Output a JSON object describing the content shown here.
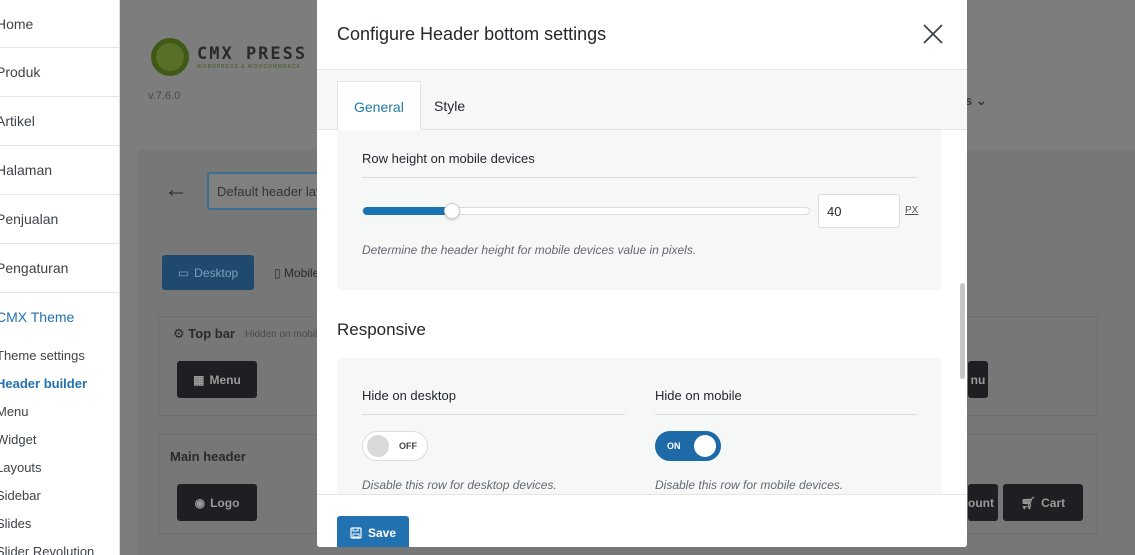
{
  "sidebar": {
    "main_items": [
      {
        "label": "Home"
      },
      {
        "label": "Produk"
      },
      {
        "label": "Artikel"
      },
      {
        "label": "Halaman"
      },
      {
        "label": "Penjualan"
      },
      {
        "label": "Pengaturan"
      }
    ],
    "active_section": "CMX Theme",
    "sub_items": [
      {
        "label": "Theme settings"
      },
      {
        "label": "Header builder"
      },
      {
        "label": "Menu"
      },
      {
        "label": "Widget"
      },
      {
        "label": "Layouts"
      },
      {
        "label": "Sidebar"
      },
      {
        "label": "Slides"
      },
      {
        "label": "Slider Revolution"
      }
    ]
  },
  "background_page": {
    "brand": "CMX PRESS",
    "tagline": "WORDPRESS & WOOCOMMERCE",
    "version": "v.7.6.0",
    "header_input": "Default header layout",
    "device_tabs": [
      "Desktop",
      "Mobile"
    ],
    "rows": {
      "top_bar": "Top bar",
      "top_bar_note": "Hidden on mobile",
      "main_header": "Main header"
    },
    "buttons": {
      "menu": "Menu",
      "logo": "Logo",
      "account": "Account",
      "cart": "Cart"
    },
    "colors": {
      "accent": "#2271b1"
    }
  },
  "modal": {
    "title": "Configure Header bottom settings",
    "tabs": [
      {
        "label": "General",
        "active": true
      },
      {
        "label": "Style",
        "active": false
      }
    ],
    "row_height": {
      "label": "Row height on mobile devices",
      "value": "40",
      "unit": "PX",
      "description": "Determine the header height for mobile devices value in pixels.",
      "slider_fraction": 0.2
    },
    "responsive": {
      "title": "Responsive",
      "hide_desktop": {
        "label": "Hide on desktop",
        "state_text": "OFF",
        "description": "Disable this row for desktop devices."
      },
      "hide_mobile": {
        "label": "Hide on mobile",
        "state_text": "ON",
        "description": "Disable this row for mobile devices."
      }
    },
    "save_label": "Save"
  }
}
